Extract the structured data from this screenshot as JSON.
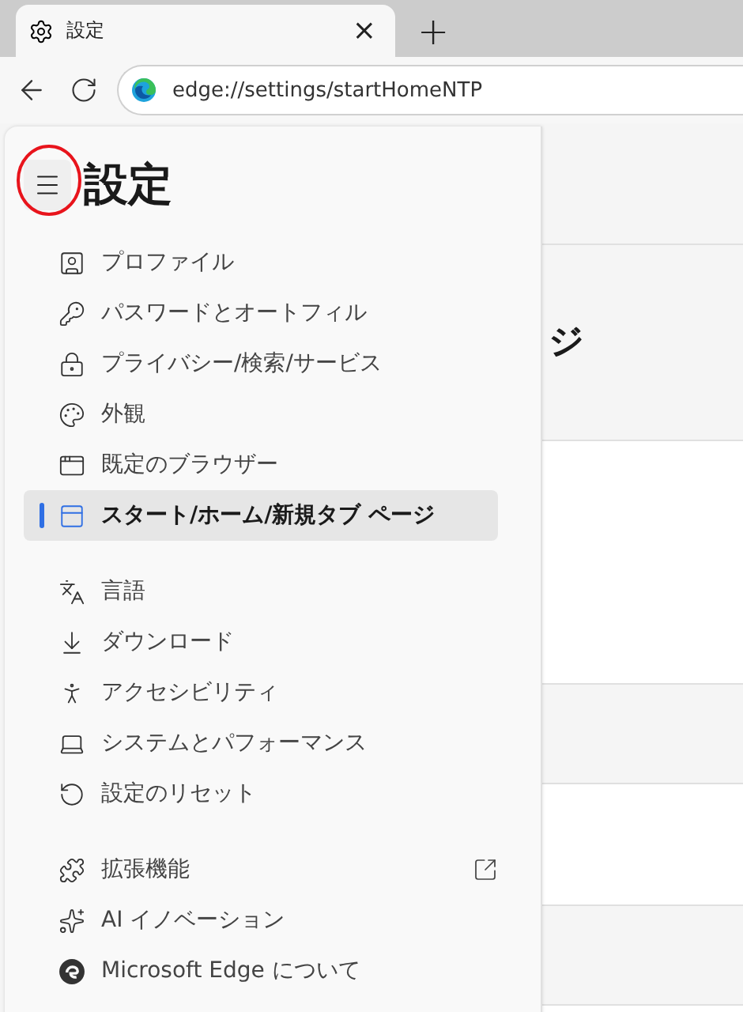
{
  "tab": {
    "title": "設定",
    "close": "×",
    "new_tab": "+"
  },
  "address_bar": {
    "value": "edge://settings/startHomeNTP"
  },
  "page_heading": "ジ",
  "sidebar": {
    "title": "設定",
    "groups": [
      {
        "items": [
          {
            "label": "プロファイル",
            "selected": false,
            "external": false
          },
          {
            "label": "パスワードとオートフィル",
            "selected": false,
            "external": false
          },
          {
            "label": "プライバシー/検索/サービス",
            "selected": false,
            "external": false
          },
          {
            "label": "外観",
            "selected": false,
            "external": false
          },
          {
            "label": "既定のブラウザー",
            "selected": false,
            "external": false
          },
          {
            "label": "スタート/ホーム/新規タブ ページ",
            "selected": true,
            "external": false
          }
        ]
      },
      {
        "items": [
          {
            "label": "言語",
            "selected": false,
            "external": false
          },
          {
            "label": "ダウンロード",
            "selected": false,
            "external": false
          },
          {
            "label": "アクセシビリティ",
            "selected": false,
            "external": false
          },
          {
            "label": "システムとパフォーマンス",
            "selected": false,
            "external": false
          },
          {
            "label": "設定のリセット",
            "selected": false,
            "external": false
          }
        ]
      },
      {
        "items": [
          {
            "label": "拡張機能",
            "selected": false,
            "external": true
          },
          {
            "label": "AI イノベーション",
            "selected": false,
            "external": false
          },
          {
            "label": "Microsoft Edge について",
            "selected": false,
            "external": false
          }
        ]
      }
    ]
  }
}
